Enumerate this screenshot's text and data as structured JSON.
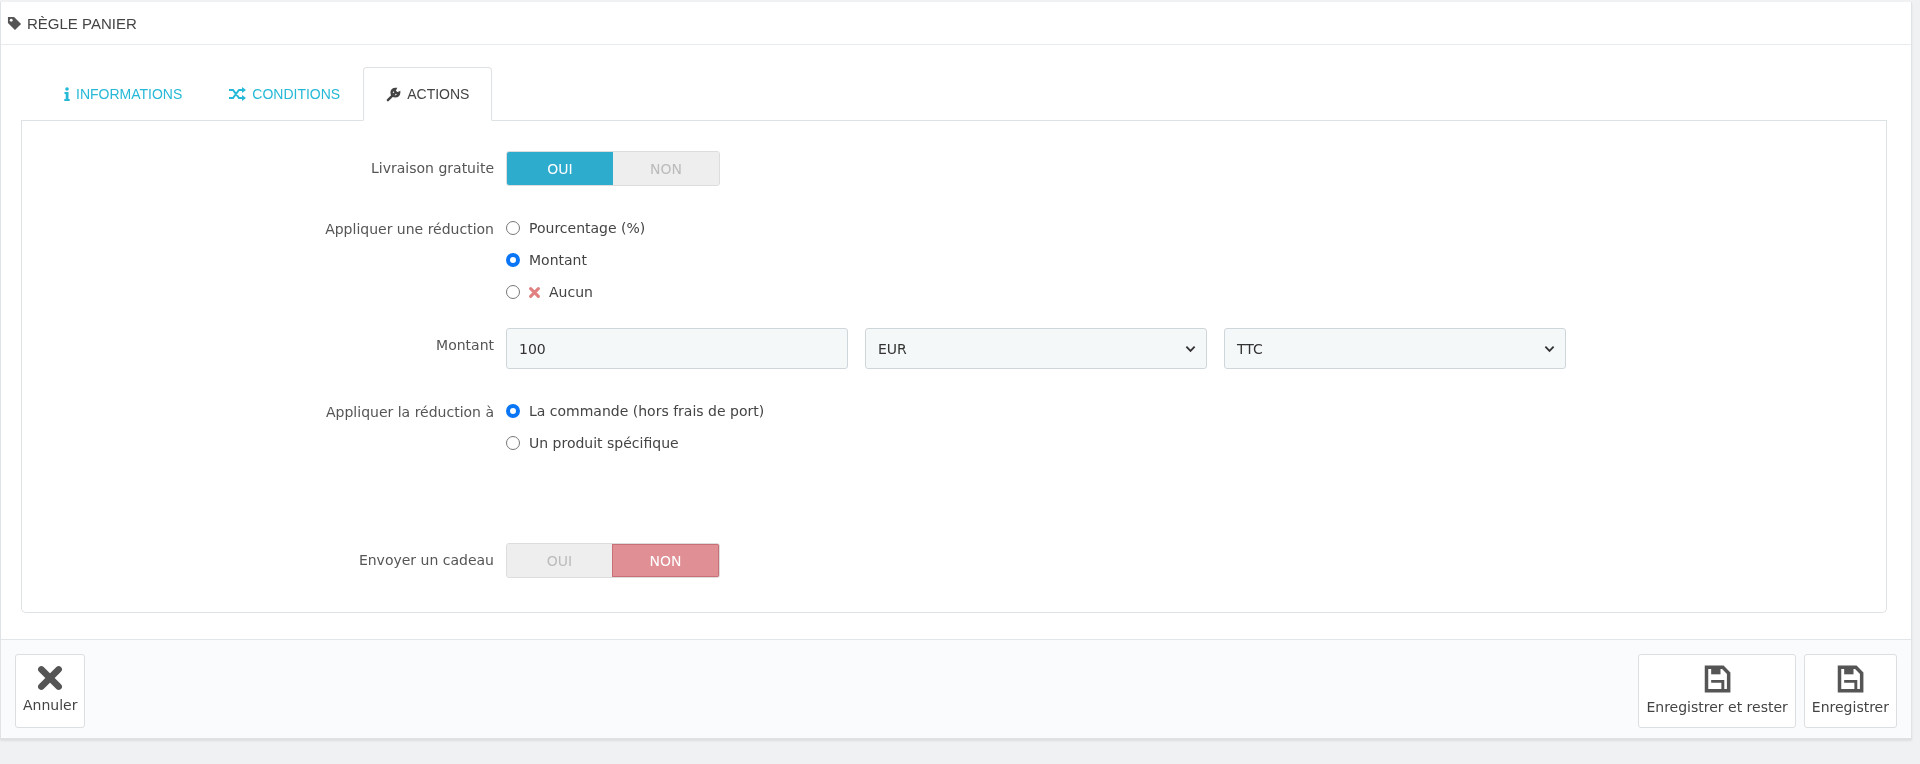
{
  "panel": {
    "title": "RÈGLE PANIER"
  },
  "tabs": [
    {
      "label": "INFORMATIONS",
      "kind": "info",
      "selected": false
    },
    {
      "label": "CONDITIONS",
      "kind": "shuffle",
      "selected": false
    },
    {
      "label": "ACTIONS",
      "kind": "wrench",
      "selected": true
    }
  ],
  "fields": [
    {
      "kind": "toggle",
      "label": "Livraison gratuite",
      "options": [
        {
          "label": "OUI",
          "selected": true
        },
        {
          "label": "NON",
          "selected": false
        }
      ]
    },
    {
      "kind": "radio",
      "label": "Appliquer une réduction",
      "options": [
        {
          "label": "Pourcentage (%)",
          "selected": false
        },
        {
          "label": "Montant",
          "selected": true
        },
        {
          "label": "Aucun",
          "selected": false,
          "kind": "none"
        }
      ]
    },
    {
      "kind": "amount",
      "label": "Montant",
      "value": "100",
      "selects": [
        "EUR",
        "TTC"
      ]
    },
    {
      "kind": "radio",
      "label": "Appliquer la réduction à",
      "options": [
        {
          "label": "La commande (hors frais de port)",
          "selected": true
        },
        {
          "label": "Un produit spécifique",
          "selected": false
        }
      ]
    },
    {
      "kind": "toggle",
      "label": "Envoyer un cadeau",
      "options": [
        {
          "label": "OUI",
          "selected": false
        },
        {
          "label": "NON",
          "selected": true
        }
      ]
    }
  ],
  "footer": {
    "left_buttons": [
      {
        "label": "Annuler",
        "kind": "cancel"
      }
    ],
    "right_buttons": [
      {
        "label": "Enregistrer et rester",
        "kind": "save"
      },
      {
        "label": "Enregistrer",
        "kind": "save"
      }
    ]
  }
}
